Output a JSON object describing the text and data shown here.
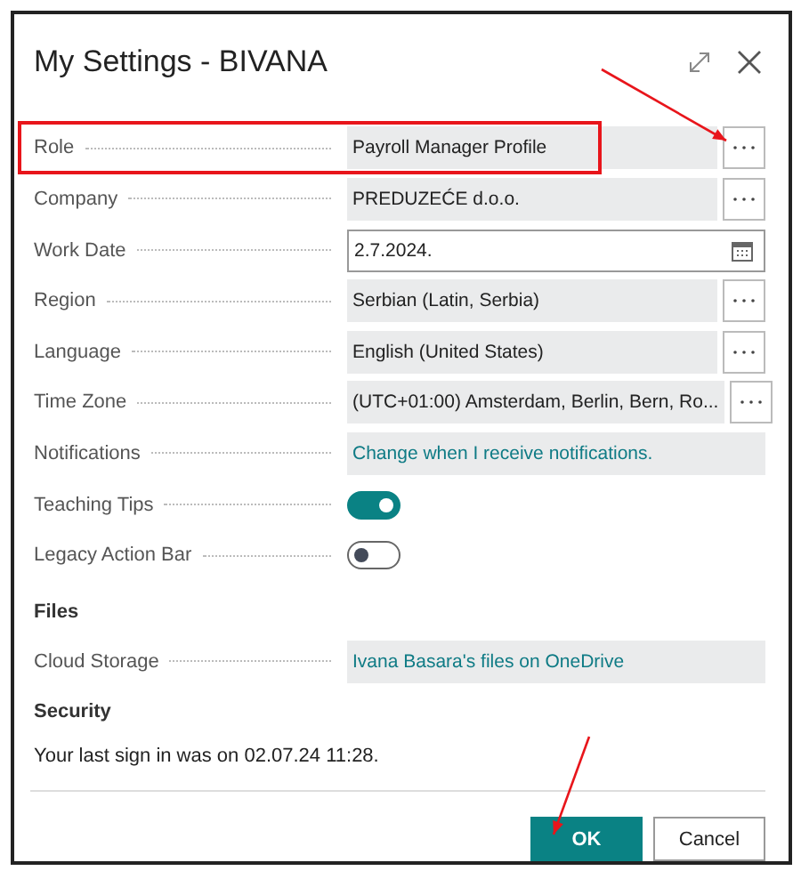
{
  "window": {
    "title": "My Settings - BIVANA"
  },
  "fields": [
    {
      "kind": "lookup",
      "label": "Role",
      "value": "Payroll Manager Profile",
      "highlighted": true,
      "arrow": true
    },
    {
      "kind": "lookup",
      "label": "Company",
      "value": "PREDUZEĆE d.o.o.",
      "highlighted": false,
      "arrow": false
    },
    {
      "kind": "date",
      "label": "Work Date",
      "value": "2.7.2024."
    },
    {
      "kind": "lookup",
      "label": "Region",
      "value": "Serbian (Latin, Serbia)",
      "highlighted": false,
      "arrow": false
    },
    {
      "kind": "lookup",
      "label": "Language",
      "value": "English (United States)",
      "highlighted": false,
      "arrow": false
    },
    {
      "kind": "lookup",
      "label": "Time Zone",
      "value": "(UTC+01:00) Amsterdam, Berlin, Bern, Ro...",
      "highlighted": false,
      "arrow": false
    },
    {
      "kind": "link",
      "label": "Notifications",
      "value": "Change when I receive notifications."
    },
    {
      "kind": "toggle",
      "label": "Teaching Tips",
      "on": true
    },
    {
      "kind": "toggle",
      "label": "Legacy Action Bar",
      "on": false
    }
  ],
  "files": {
    "heading": "Files",
    "fields": [
      {
        "kind": "link",
        "label": "Cloud Storage",
        "value": "Ivana Basara's files on OneDrive"
      }
    ]
  },
  "security": {
    "heading": "Security",
    "text": "Your last sign in was on 02.07.24 11:28."
  },
  "buttons": [
    {
      "label": "OK",
      "primary": true,
      "arrow": true
    },
    {
      "label": "Cancel",
      "primary": false,
      "arrow": false
    }
  ]
}
